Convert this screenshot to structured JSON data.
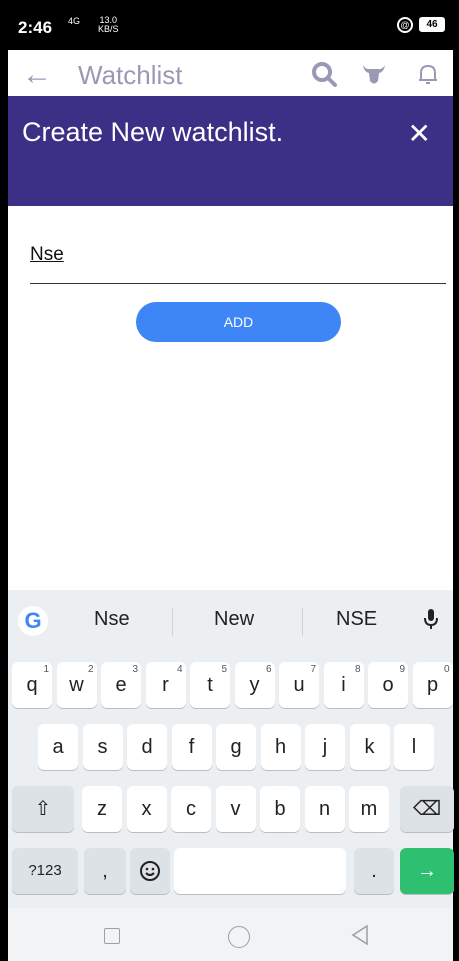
{
  "status_bar": {
    "time": "2:46",
    "network": "4G",
    "speed_value": "13.0",
    "speed_unit": "KB/S",
    "battery": "46"
  },
  "app_bar": {
    "title": "Watchlist"
  },
  "modal": {
    "title": "Create New watchlist.",
    "input_value": "Nse",
    "add_label": "ADD"
  },
  "keyboard": {
    "suggestions": [
      "Nse",
      "New",
      "NSE"
    ],
    "row1": [
      {
        "k": "q",
        "n": "1"
      },
      {
        "k": "w",
        "n": "2"
      },
      {
        "k": "e",
        "n": "3"
      },
      {
        "k": "r",
        "n": "4"
      },
      {
        "k": "t",
        "n": "5"
      },
      {
        "k": "y",
        "n": "6"
      },
      {
        "k": "u",
        "n": "7"
      },
      {
        "k": "i",
        "n": "8"
      },
      {
        "k": "o",
        "n": "9"
      },
      {
        "k": "p",
        "n": "0"
      }
    ],
    "row2": [
      "a",
      "s",
      "d",
      "f",
      "g",
      "h",
      "j",
      "k",
      "l"
    ],
    "row3": [
      "z",
      "x",
      "c",
      "v",
      "b",
      "n",
      "m"
    ],
    "symbols_label": "?123",
    "comma_label": ",",
    "period_label": ".",
    "enter_symbol": "→",
    "shift_symbol": "⇧",
    "backspace_symbol": "⌫"
  }
}
